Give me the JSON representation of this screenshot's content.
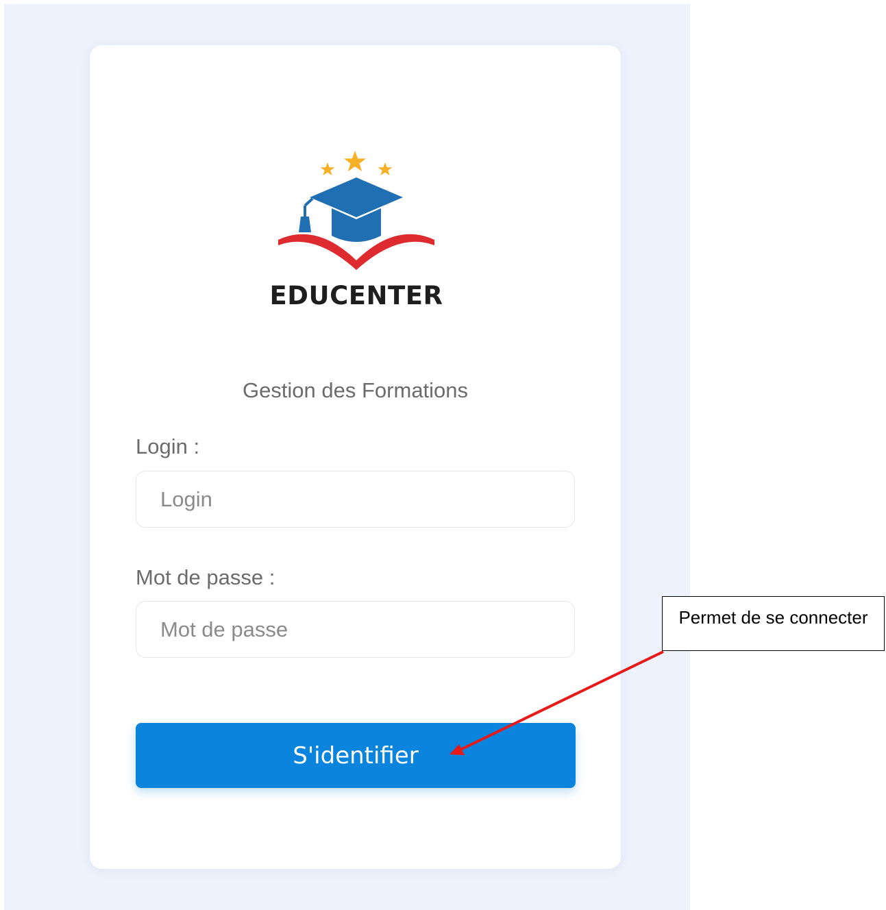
{
  "logo": {
    "brand": "EDUCENTER",
    "icon": "graduation-cap-on-book-with-stars"
  },
  "subtitle": "Gestion des Formations",
  "form": {
    "login_label": "Login :",
    "login_placeholder": "Login",
    "login_value": "",
    "password_label": "Mot de passe :",
    "password_placeholder": "Mot de passe",
    "password_value": "",
    "submit_label": "S'identifier"
  },
  "annotation": {
    "callout_text": "Permet de se connecter",
    "arrow_color": "#e81919"
  },
  "colors": {
    "page_background": "#edf2fc",
    "card_background": "#ffffff",
    "primary_button": "#0a84dc",
    "cap_blue": "#1f6fb2",
    "book_red": "#de2b2f",
    "star_gold": "#f5b026"
  }
}
